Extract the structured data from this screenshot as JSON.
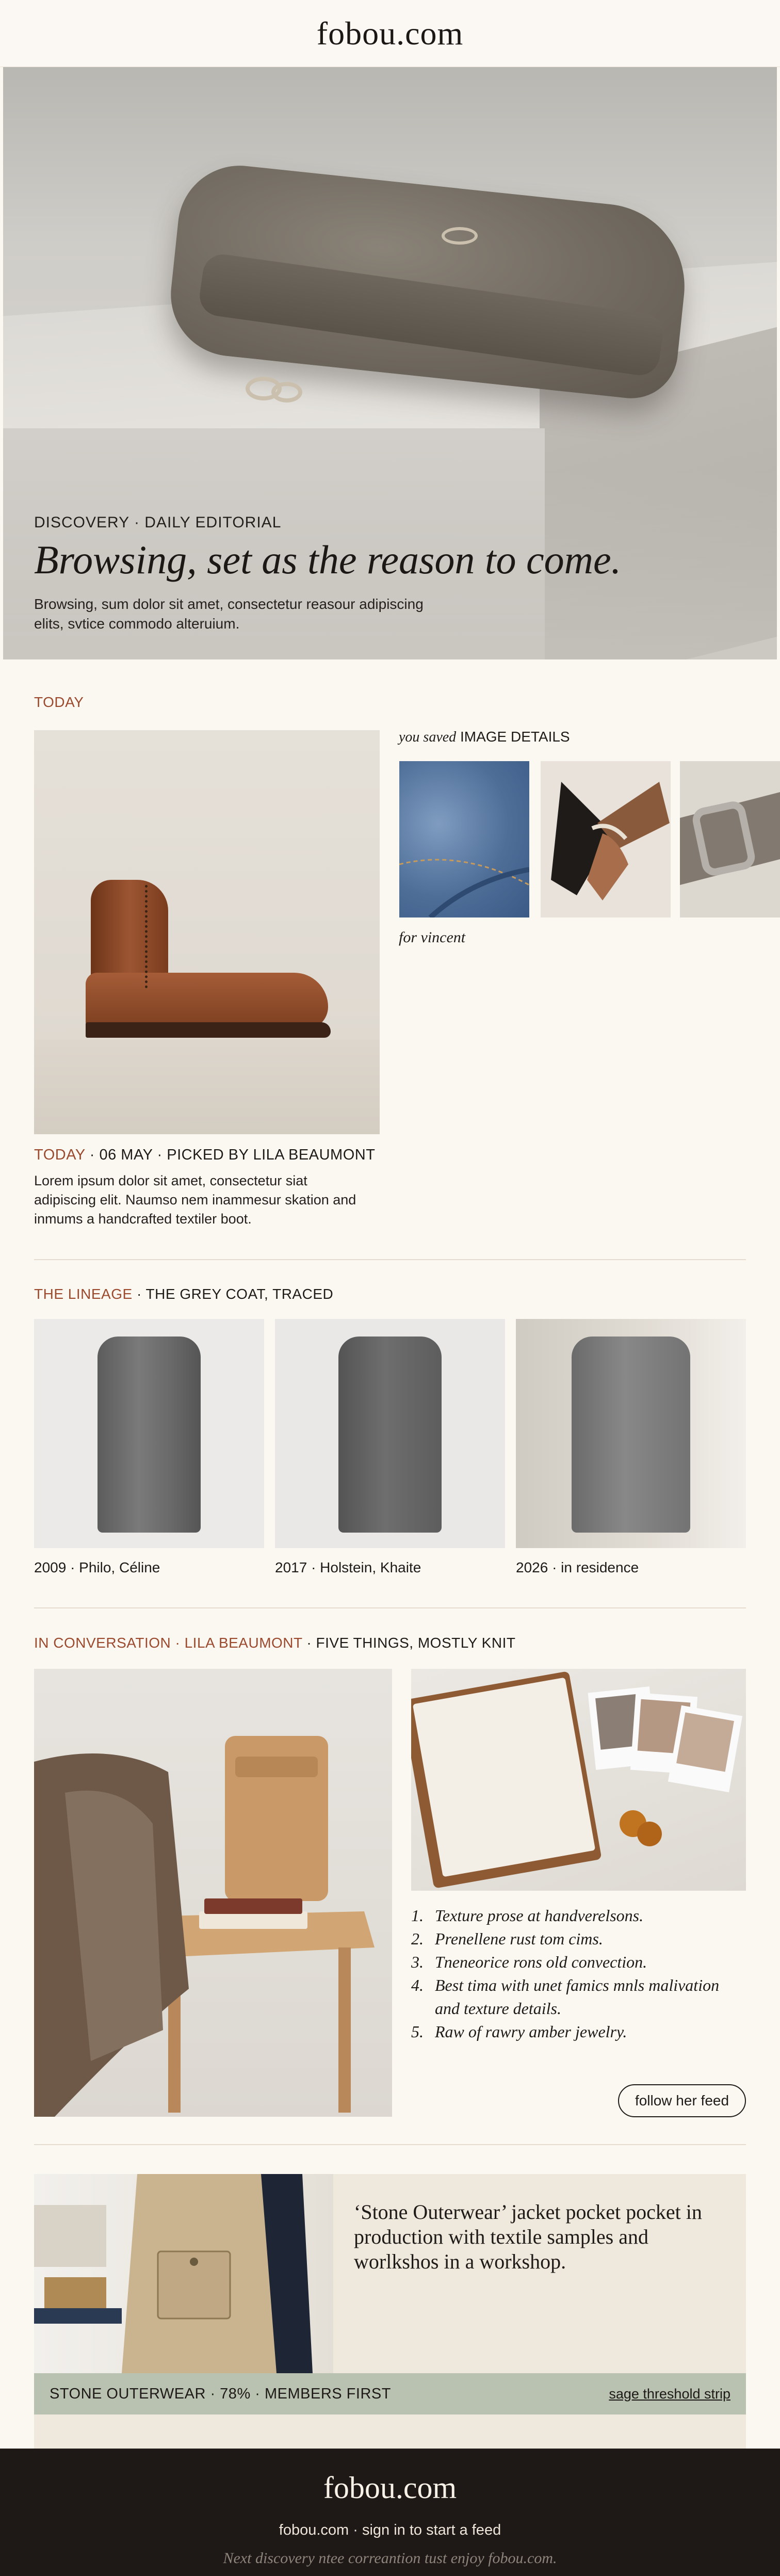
{
  "header": {
    "logo": "fobou.com"
  },
  "hero": {
    "kicker": "DISCOVERY · DAILY EDITORIAL",
    "headline": "Browsing, set as the reason to come.",
    "dek": "Browsing, sum dolor sit amet, consectetur reasour adipiscing elits, svtice commodo alteruium."
  },
  "today": {
    "section_label": "TODAY",
    "caption_accent": "TODAY",
    "caption_rest": " · 06 MAY · PICKED BY LILA BEAUMONT",
    "body": "Lorem ipsum dolor sit amet, consectetur siat adipiscing elit. Naumso nem inammesur skation and inmums a handcrafted textiler boot.",
    "saved_italic": "you saved",
    "saved_rest": " IMAGE DETAILS",
    "for_line": "for vincent"
  },
  "lineage": {
    "label_accent": "THE LINEAGE",
    "label_rest": " · THE GREY COAT, TRACED",
    "items": [
      {
        "label": "2009 · Philo, Céline"
      },
      {
        "label": "2017 · Holstein, Khaite"
      },
      {
        "label": "2026 · in residence"
      }
    ]
  },
  "conversation": {
    "label_accent": "IN CONVERSATION · LILA BEAUMONT",
    "label_rest": " · FIVE THINGS, MOSTLY KNIT",
    "list": [
      {
        "n": "1.",
        "text": "Texture prose at handverelsons."
      },
      {
        "n": "2.",
        "text": "Prenellene rust tom cims."
      },
      {
        "n": "3.",
        "text": "Tneneorice rons old convection."
      },
      {
        "n": "4.",
        "text": "Best tima with unet famics mnls malivation and texture details."
      },
      {
        "n": "5.",
        "text": "Raw of rawry amber jewelry."
      }
    ],
    "follow_label": "follow her feed"
  },
  "promo": {
    "text": "‘Stone Outerwear’ jacket pocket pocket in production with textile samples and worlkshos in a workshop.",
    "strip_meta": "STONE OUTERWEAR · 78% · MEMBERS FIRST",
    "strip_link": "sage threshold strip"
  },
  "footer": {
    "logo": "fobou.com",
    "sign": "fobou.com · sign in to start a feed",
    "note": "Next discovery ntee correantion tust enjoy fobou.com."
  },
  "colors": {
    "accent": "#9b4a2e",
    "background": "#fbf7f1",
    "footer": "#1e1816",
    "sage": "#b9c2b0"
  }
}
